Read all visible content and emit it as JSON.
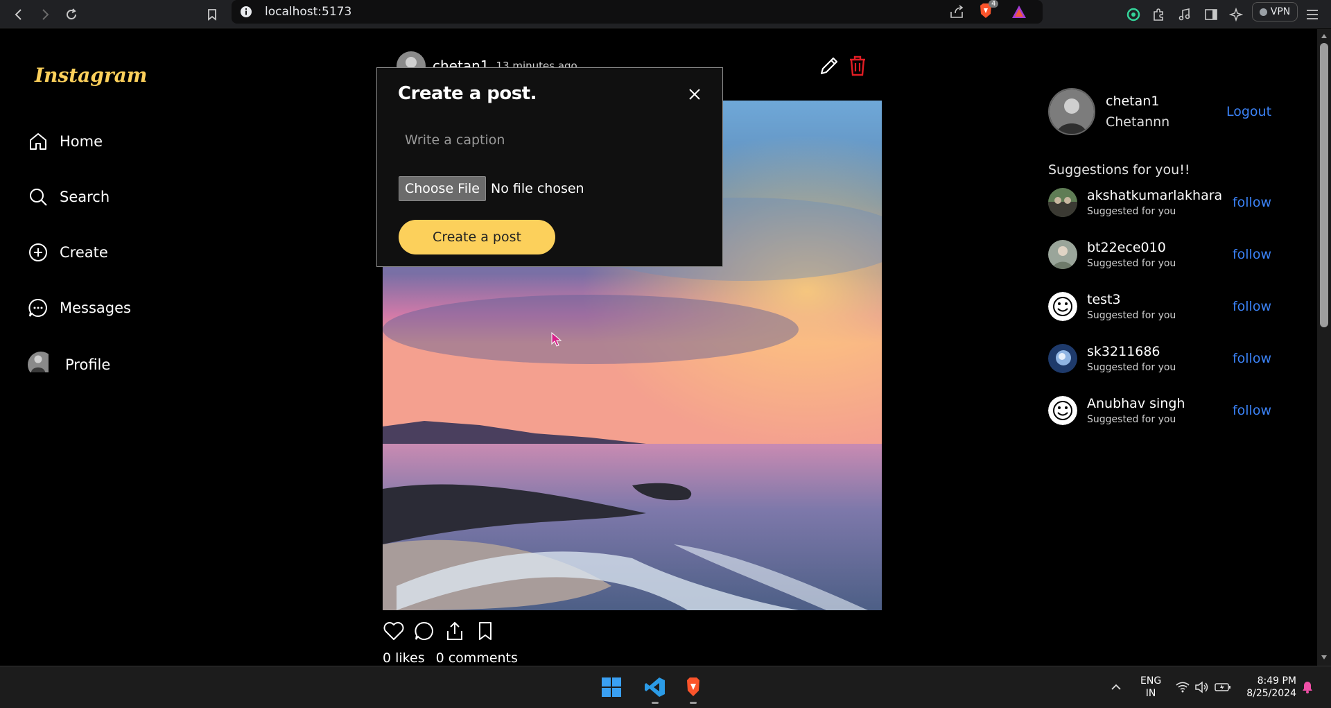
{
  "browser": {
    "url": "localhost:5173",
    "brave_badge": "4",
    "vpn_label": "VPN"
  },
  "sidebar": {
    "logo": "Instagram",
    "items": [
      {
        "label": "Home",
        "icon": "home-icon"
      },
      {
        "label": "Search",
        "icon": "search-icon"
      },
      {
        "label": "Create",
        "icon": "plus-circle-icon"
      },
      {
        "label": "Messages",
        "icon": "chat-bubble-icon"
      },
      {
        "label": "Profile",
        "icon": "avatar"
      }
    ]
  },
  "post": {
    "username": "chetan1",
    "time": "13 minutes ago",
    "likes": "0 likes",
    "comments": "0 comments",
    "image": "sunset-over-sea-photo"
  },
  "modal": {
    "title": "Create a post.",
    "caption_placeholder": "Write a caption",
    "choose_file_label": "Choose File",
    "file_status": "No file chosen",
    "submit_label": "Create a post"
  },
  "current_user": {
    "username": "chetan1",
    "full_name": "Chetannn",
    "logout_label": "Logout"
  },
  "suggestions": {
    "title": "Suggestions for you!!",
    "items": [
      {
        "username": "akshatkumarlakhara",
        "subtitle": "Suggested for you",
        "action": "follow"
      },
      {
        "username": "bt22ece010",
        "subtitle": "Suggested for you",
        "action": "follow"
      },
      {
        "username": "test3",
        "subtitle": "Suggested for you",
        "action": "follow"
      },
      {
        "username": "sk3211686",
        "subtitle": "Suggested for you",
        "action": "follow"
      },
      {
        "username": "Anubhav singh",
        "subtitle": "Suggested for you",
        "action": "follow"
      }
    ]
  },
  "taskbar": {
    "lang_top": "ENG",
    "lang_bottom": "IN",
    "time": "8:49 PM",
    "date": "8/25/2024"
  },
  "colors": {
    "accent": "#fcd05b",
    "link": "#3b82f6",
    "delete": "#e11d24"
  }
}
